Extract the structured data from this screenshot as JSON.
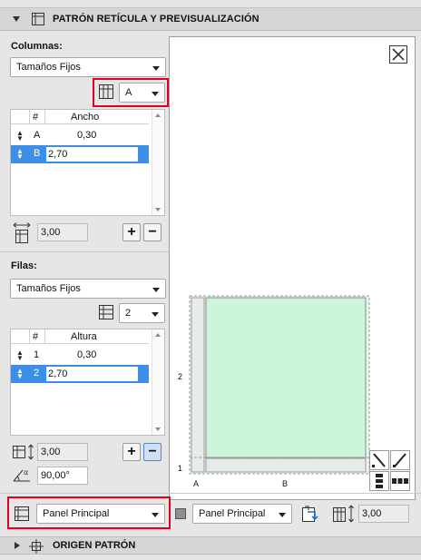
{
  "header": {
    "title": "PATRÓN RETÍCULA Y PREVISUALIZACIÓN"
  },
  "columns": {
    "label": "Columnas:",
    "mode": "Tamaños Fijos",
    "selector_value": "A",
    "table": {
      "headers": [
        "#",
        "Ancho"
      ],
      "rows": [
        {
          "id": "A",
          "value": "0,30",
          "selected": false
        },
        {
          "id": "B",
          "value": "2,70",
          "selected": true
        }
      ]
    },
    "total": "3,00"
  },
  "rows_section": {
    "label": "Filas:",
    "mode": "Tamaños Fijos",
    "selector_value": "2",
    "table": {
      "headers": [
        "#",
        "Altura"
      ],
      "rows": [
        {
          "id": "1",
          "value": "0,30",
          "selected": false
        },
        {
          "id": "2",
          "value": "2,70",
          "selected": true
        }
      ]
    },
    "total": "3,00",
    "angle": "90,00°"
  },
  "preview": {
    "col_labels": [
      "A",
      "B"
    ],
    "row_labels": [
      "1",
      "2"
    ]
  },
  "bottom_bar": {
    "panel_dropdown": "Panel Principal",
    "panel_dropdown_2": "Panel Principal",
    "size_value": "3,00"
  },
  "footer": {
    "title": "ORIGEN PATRÓN"
  },
  "colors": {
    "selection": "#3d8ee6",
    "preview_fill": "#ccf5d9",
    "highlight": "#e4001b"
  }
}
